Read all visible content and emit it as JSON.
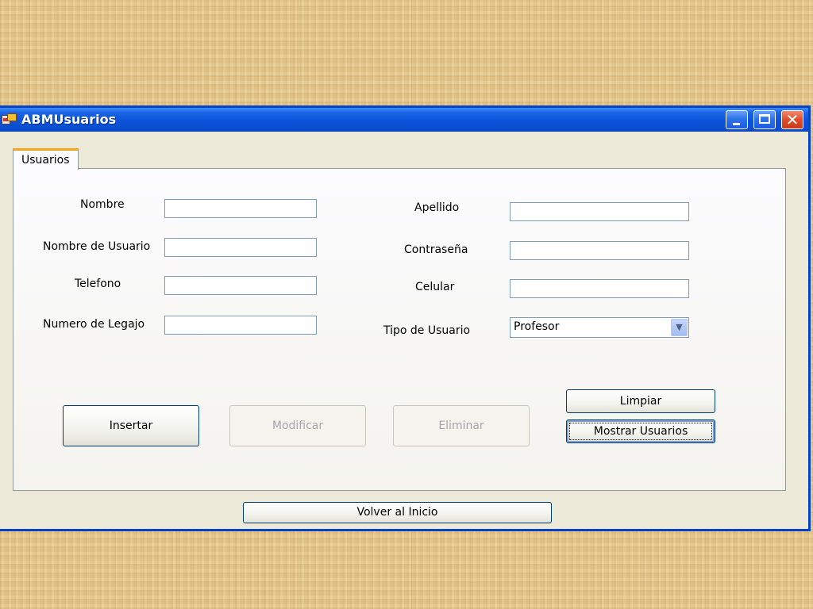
{
  "window": {
    "title": "ABMUsuarios"
  },
  "tabs": [
    {
      "label": "Usuarios"
    }
  ],
  "form": {
    "nombre": {
      "label": "Nombre",
      "value": ""
    },
    "nombre_usuario": {
      "label": "Nombre de Usuario",
      "value": ""
    },
    "telefono": {
      "label": "Telefono",
      "value": ""
    },
    "numero_legajo": {
      "label": "Numero de Legajo",
      "value": ""
    },
    "apellido": {
      "label": "Apellido",
      "value": ""
    },
    "contrasena": {
      "label": "Contraseña",
      "value": ""
    },
    "celular": {
      "label": "Celular",
      "value": ""
    },
    "tipo_usuario": {
      "label": "Tipo de Usuario",
      "selected": "Profesor"
    }
  },
  "buttons": {
    "insertar": "Insertar",
    "modificar": "Modificar",
    "eliminar": "Eliminar",
    "limpiar": "Limpiar",
    "mostrar_usuarios": "Mostrar Usuarios",
    "volver": "Volver al Inicio"
  },
  "colors": {
    "titlebar": "#0a52d8",
    "window_bg": "#ece9d8",
    "tab_accent": "#f4a41a",
    "button_border": "#003c74",
    "disabled_text": "#a7a6aa"
  }
}
